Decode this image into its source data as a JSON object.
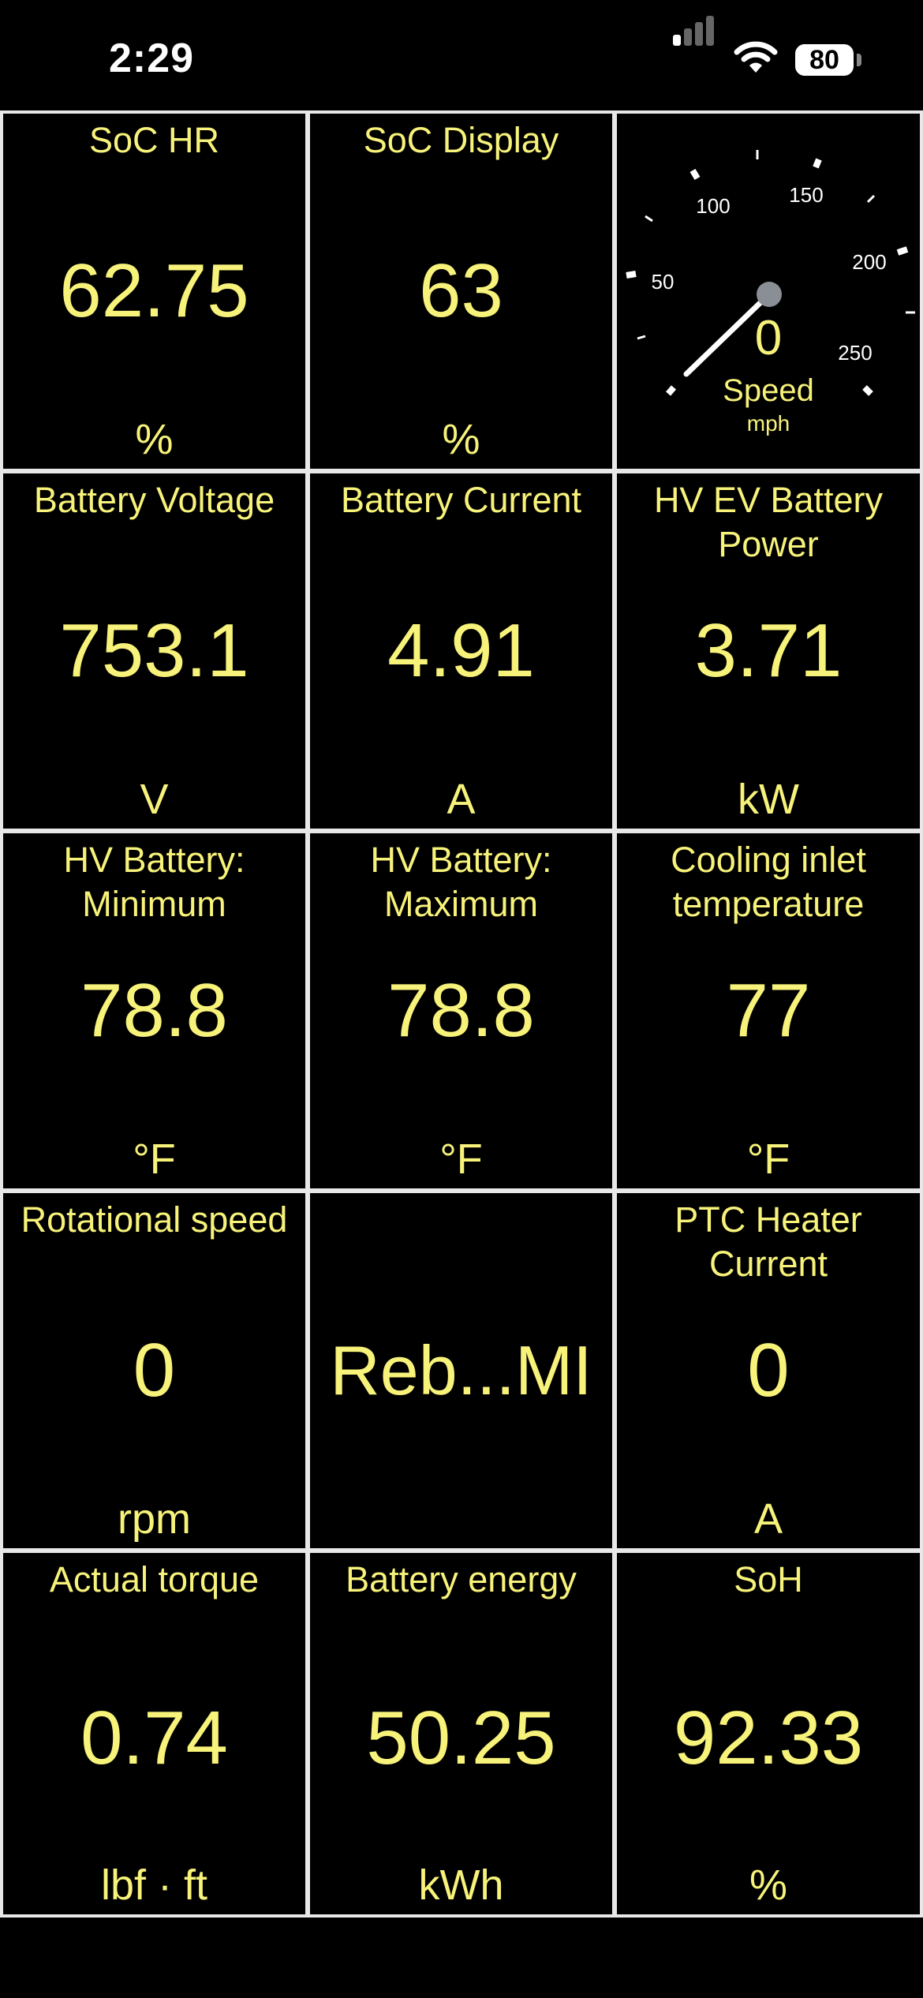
{
  "status_bar": {
    "time": "2:29",
    "battery_level": "80"
  },
  "tiles": [
    {
      "label": "SoC HR",
      "value": "62.75",
      "unit": "%"
    },
    {
      "label": "SoC Display",
      "value": "63",
      "unit": "%"
    },
    {
      "gauge": true,
      "value": "0",
      "label": "Speed",
      "unit": "mph",
      "ticks": [
        "50",
        "100",
        "150",
        "200",
        "250"
      ]
    },
    {
      "label": "Battery Voltage",
      "value": "753.1",
      "unit": "V"
    },
    {
      "label": "Battery Current",
      "value": "4.91",
      "unit": "A"
    },
    {
      "label": "HV EV Battery Power",
      "value": "3.71",
      "unit": "kW"
    },
    {
      "label": "HV Battery: Minimum",
      "value": "78.8",
      "unit": "°F"
    },
    {
      "label": "HV Battery: Maximum",
      "value": "78.8",
      "unit": "°F"
    },
    {
      "label": "Cooling inlet temperature",
      "value": "77",
      "unit": "°F"
    },
    {
      "label": "Rotational speed",
      "value": "0",
      "unit": "rpm"
    },
    {
      "label": "",
      "value": "Reb...MI",
      "unit": ""
    },
    {
      "label": "PTC Heater Current",
      "value": "0",
      "unit": "A"
    },
    {
      "label": "Actual torque",
      "value": "0.74",
      "unit": "lbf · ft"
    },
    {
      "label": "Battery energy",
      "value": "50.25",
      "unit": "kWh"
    },
    {
      "label": "SoH",
      "value": "92.33",
      "unit": "%"
    }
  ],
  "colors": {
    "accent": "#f7f27a",
    "background": "#000000",
    "grid_line": "#e8e8e8"
  }
}
